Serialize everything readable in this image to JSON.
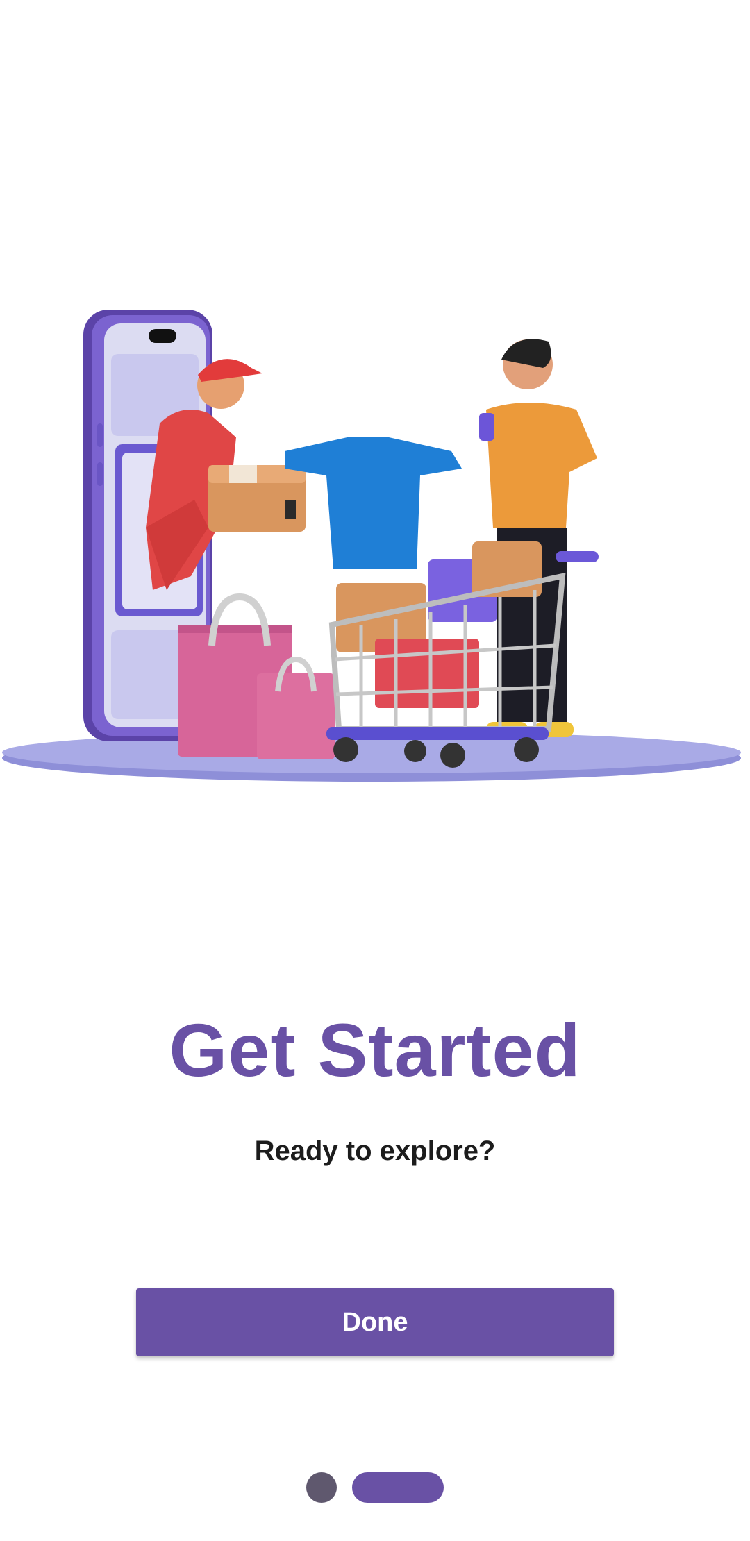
{
  "onboarding": {
    "title": "Get Started",
    "subtitle": "Ready to explore?",
    "done_label": "Done",
    "page_indicator": {
      "total": 2,
      "current": 2
    }
  },
  "colors": {
    "accent": "#6951a5",
    "text": "#1c1c1c",
    "inactive_dot": "#5f586e",
    "background": "#ffffff"
  },
  "illustration": {
    "icon": "online-shopping-illustration"
  }
}
